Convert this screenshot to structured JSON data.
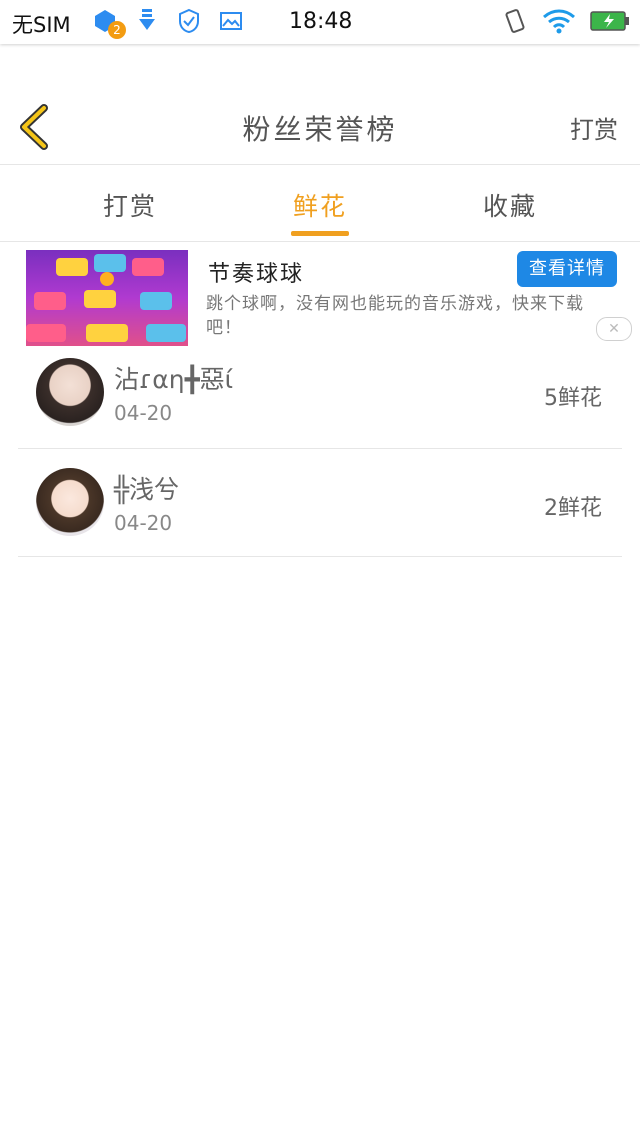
{
  "status_bar": {
    "carrier": "无SIM",
    "notification_badge": "2",
    "time": "18:48"
  },
  "header": {
    "title": "粉丝荣誉榜",
    "right_action": "打赏"
  },
  "tabs": [
    {
      "label": "打赏",
      "active": false
    },
    {
      "label": "鲜花",
      "active": true
    },
    {
      "label": "收藏",
      "active": false
    }
  ],
  "ad": {
    "title": "节奏球球",
    "description": "跳个球啊，没有网也能玩的音乐游戏，快来下载吧！",
    "button_label": "查看详情",
    "close_label": "✕"
  },
  "fans": [
    {
      "name": "沾ɾαη╋惡ί",
      "date": "04-20",
      "count": "5鲜花"
    },
    {
      "name": "╬浅兮",
      "date": "04-20",
      "count": "2鲜花"
    }
  ],
  "colors": {
    "accent": "#f0a020",
    "ad_button": "#1e88e5"
  }
}
